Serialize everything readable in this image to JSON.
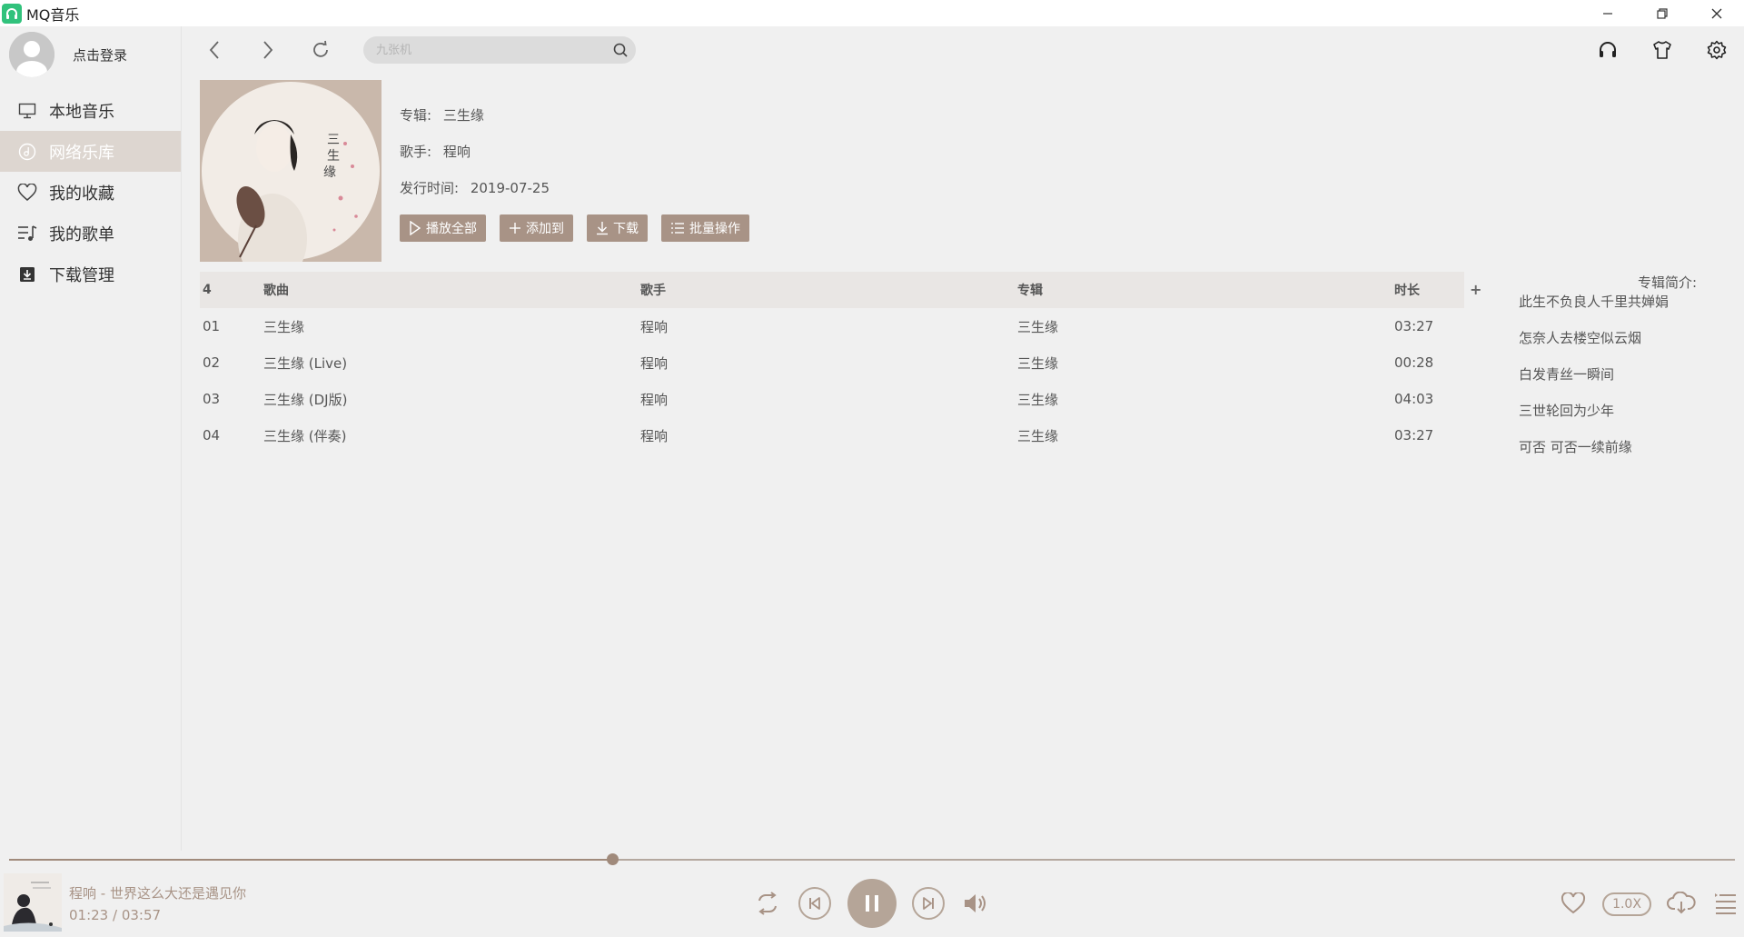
{
  "window": {
    "title": "MQ音乐",
    "minimize_icon": "minimize-icon",
    "maximize_icon": "restore-icon",
    "close_icon": "close-icon"
  },
  "sidebar": {
    "login_text": "点击登录",
    "items": [
      {
        "label": "本地音乐",
        "icon": "monitor-icon",
        "active": false
      },
      {
        "label": "网络乐库",
        "icon": "music-disc-icon",
        "active": true
      },
      {
        "label": "我的收藏",
        "icon": "heart-icon",
        "active": false
      },
      {
        "label": "我的歌单",
        "icon": "playlist-icon",
        "active": false
      },
      {
        "label": "下载管理",
        "icon": "download-box-icon",
        "active": false
      }
    ]
  },
  "topbar": {
    "search_placeholder": "九张机"
  },
  "album": {
    "album_label": "专辑:",
    "album_name": "三生缘",
    "artist_label": "歌手:",
    "artist_name": "程响",
    "release_label": "发行时间:",
    "release_date": "2019-07-25",
    "buttons": {
      "play_all": "播放全部",
      "add_to": "添加到",
      "download": "下载",
      "batch": "批量操作"
    }
  },
  "table": {
    "count": "4",
    "headers": {
      "song": "歌曲",
      "artist": "歌手",
      "album": "专辑",
      "duration": "时长"
    },
    "add_column": "+",
    "rows": [
      {
        "no": "01",
        "song": "三生缘",
        "artist": "程响",
        "album": "三生缘",
        "duration": "03:27"
      },
      {
        "no": "02",
        "song": "三生缘 (Live)",
        "artist": "程响",
        "album": "三生缘",
        "duration": "00:28"
      },
      {
        "no": "03",
        "song": "三生缘 (DJ版)",
        "artist": "程响",
        "album": "三生缘",
        "duration": "04:03"
      },
      {
        "no": "04",
        "song": "三生缘 (伴奏)",
        "artist": "程响",
        "album": "三生缘",
        "duration": "03:27"
      }
    ]
  },
  "intro": {
    "title": "专辑简介:",
    "lines": [
      "此生不负良人千里共婵娟",
      "怎奈人去楼空似云烟",
      "白发青丝一瞬间",
      "三世轮回为少年",
      "可否 可否一续前缘"
    ]
  },
  "player": {
    "now_playing": "程响 - 世界这么大还是遇见你",
    "time": "01:23 / 03:57",
    "progress_fraction": 0.3495,
    "speed": "1.0X",
    "accent_color": "#b5a598"
  }
}
